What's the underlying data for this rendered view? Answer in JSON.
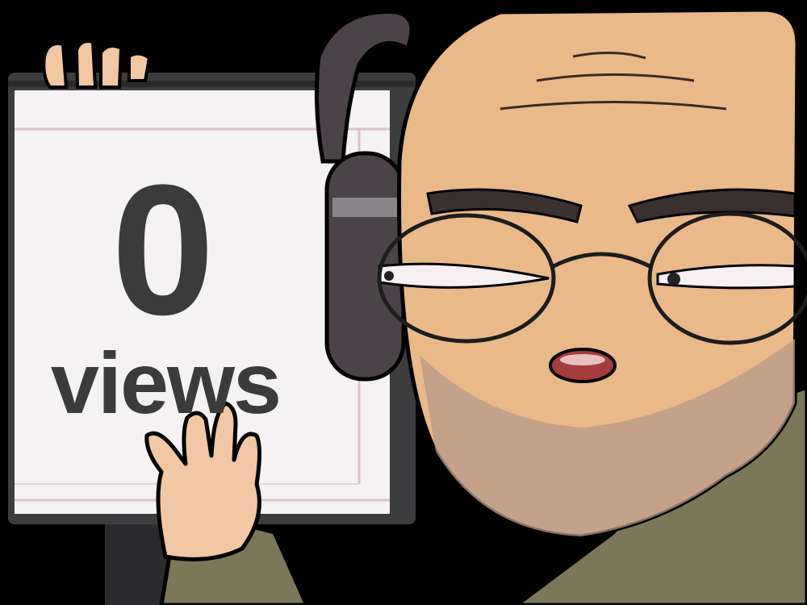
{
  "monitor": {
    "count": "0",
    "unit": "views"
  },
  "colors": {
    "background": "#000000",
    "screen": "#f4f2f3",
    "monitor_frame": "#3d3d3f",
    "skin": "#e9b98a",
    "skin_shadow": "#c89065",
    "beard": "#b79a88",
    "jacket": "#7a7858",
    "headphones": "#4a4448",
    "text": "#3b3b3b"
  },
  "icons": [
    "monitor-icon",
    "headphones-icon",
    "hand-icon",
    "glasses-icon"
  ]
}
